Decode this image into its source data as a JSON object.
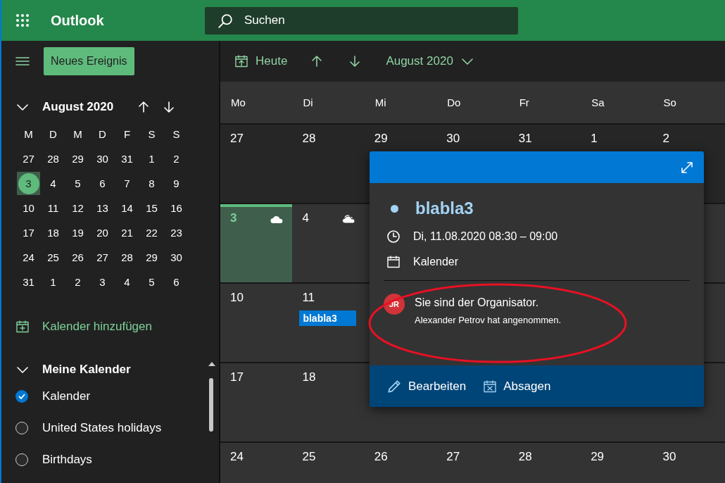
{
  "top_bar": {
    "app_title": "Outlook",
    "search": {
      "placeholder": "Suchen"
    }
  },
  "sidebar": {
    "new_button": "Neues Ereignis",
    "mini_calendar": {
      "title": "August 2020",
      "weekdays": [
        "M",
        "D",
        "M",
        "D",
        "F",
        "S",
        "S"
      ],
      "weeks": [
        [
          {
            "label": "27",
            "selected": false
          },
          {
            "label": "28",
            "selected": false
          },
          {
            "label": "29",
            "selected": false
          },
          {
            "label": "30",
            "selected": false
          },
          {
            "label": "31",
            "selected": false
          },
          {
            "label": "1",
            "selected": false
          },
          {
            "label": "2",
            "selected": false
          }
        ],
        [
          {
            "label": "3",
            "selected": true
          },
          {
            "label": "4",
            "selected": false
          },
          {
            "label": "5",
            "selected": false
          },
          {
            "label": "6",
            "selected": false
          },
          {
            "label": "7",
            "selected": false
          },
          {
            "label": "8",
            "selected": false
          },
          {
            "label": "9",
            "selected": false
          }
        ],
        [
          {
            "label": "10",
            "selected": false
          },
          {
            "label": "11",
            "selected": false
          },
          {
            "label": "12",
            "selected": false
          },
          {
            "label": "13",
            "selected": false
          },
          {
            "label": "14",
            "selected": false
          },
          {
            "label": "15",
            "selected": false
          },
          {
            "label": "16",
            "selected": false
          }
        ],
        [
          {
            "label": "17",
            "selected": false
          },
          {
            "label": "18",
            "selected": false
          },
          {
            "label": "19",
            "selected": false
          },
          {
            "label": "20",
            "selected": false
          },
          {
            "label": "21",
            "selected": false
          },
          {
            "label": "22",
            "selected": false
          },
          {
            "label": "23",
            "selected": false
          }
        ],
        [
          {
            "label": "24",
            "selected": false
          },
          {
            "label": "25",
            "selected": false
          },
          {
            "label": "26",
            "selected": false
          },
          {
            "label": "27",
            "selected": false
          },
          {
            "label": "28",
            "selected": false
          },
          {
            "label": "29",
            "selected": false
          },
          {
            "label": "30",
            "selected": false
          }
        ],
        [
          {
            "label": "31",
            "selected": false
          },
          {
            "label": "1",
            "selected": false
          },
          {
            "label": "2",
            "selected": false
          },
          {
            "label": "3",
            "selected": false
          },
          {
            "label": "4",
            "selected": false
          },
          {
            "label": "5",
            "selected": false
          },
          {
            "label": "6",
            "selected": false
          }
        ]
      ]
    },
    "add_calendar": "Kalender hinzufügen",
    "group": {
      "title": "Meine Kalender",
      "expanded": true,
      "items": [
        {
          "label": "Kalender",
          "checked": true
        },
        {
          "label": "United States holidays",
          "checked": false
        },
        {
          "label": "Birthdays",
          "checked": false
        }
      ]
    }
  },
  "toolbar": {
    "today": "Heute",
    "month": "August 2020"
  },
  "calendar": {
    "weekdays": [
      "Mo",
      "Di",
      "Mi",
      "Do",
      "Fr",
      "Sa",
      "So"
    ],
    "weeks": [
      [
        {
          "label": "27",
          "past": true
        },
        {
          "label": "28",
          "past": true
        },
        {
          "label": "29",
          "past": true
        },
        {
          "label": "30",
          "past": true
        },
        {
          "label": "31",
          "past": true
        },
        {
          "label": "1",
          "past": true
        },
        {
          "label": "2",
          "past": true
        }
      ],
      [
        {
          "label": "3",
          "today": true,
          "weather": true,
          "night": true
        },
        {
          "label": "4",
          "weather": true,
          "night": false
        }
      ],
      [
        {
          "label": "10"
        },
        {
          "label": "11",
          "events": [
            "blabla3"
          ]
        }
      ],
      [
        {
          "label": "17"
        },
        {
          "label": "18"
        }
      ],
      [
        {
          "label": "24"
        },
        {
          "label": "25"
        },
        {
          "label": "26"
        },
        {
          "label": "27"
        },
        {
          "label": "28"
        },
        {
          "label": "29"
        },
        {
          "label": "30"
        }
      ]
    ]
  },
  "event_popup": {
    "title": "blabla3",
    "time": "Di, 11.08.2020 08:30 – 09:00",
    "calendar": "Kalender",
    "organizer": {
      "initials": "JR",
      "status": "Sie sind der Organisator.",
      "response": "Alexander Petrov hat angenommen."
    },
    "actions": [
      {
        "kind": "edit",
        "label": "Bearbeiten"
      },
      {
        "kind": "cancel",
        "label": "Absagen"
      }
    ]
  },
  "annotations": [
    {
      "kind": "ellipse"
    }
  ]
}
